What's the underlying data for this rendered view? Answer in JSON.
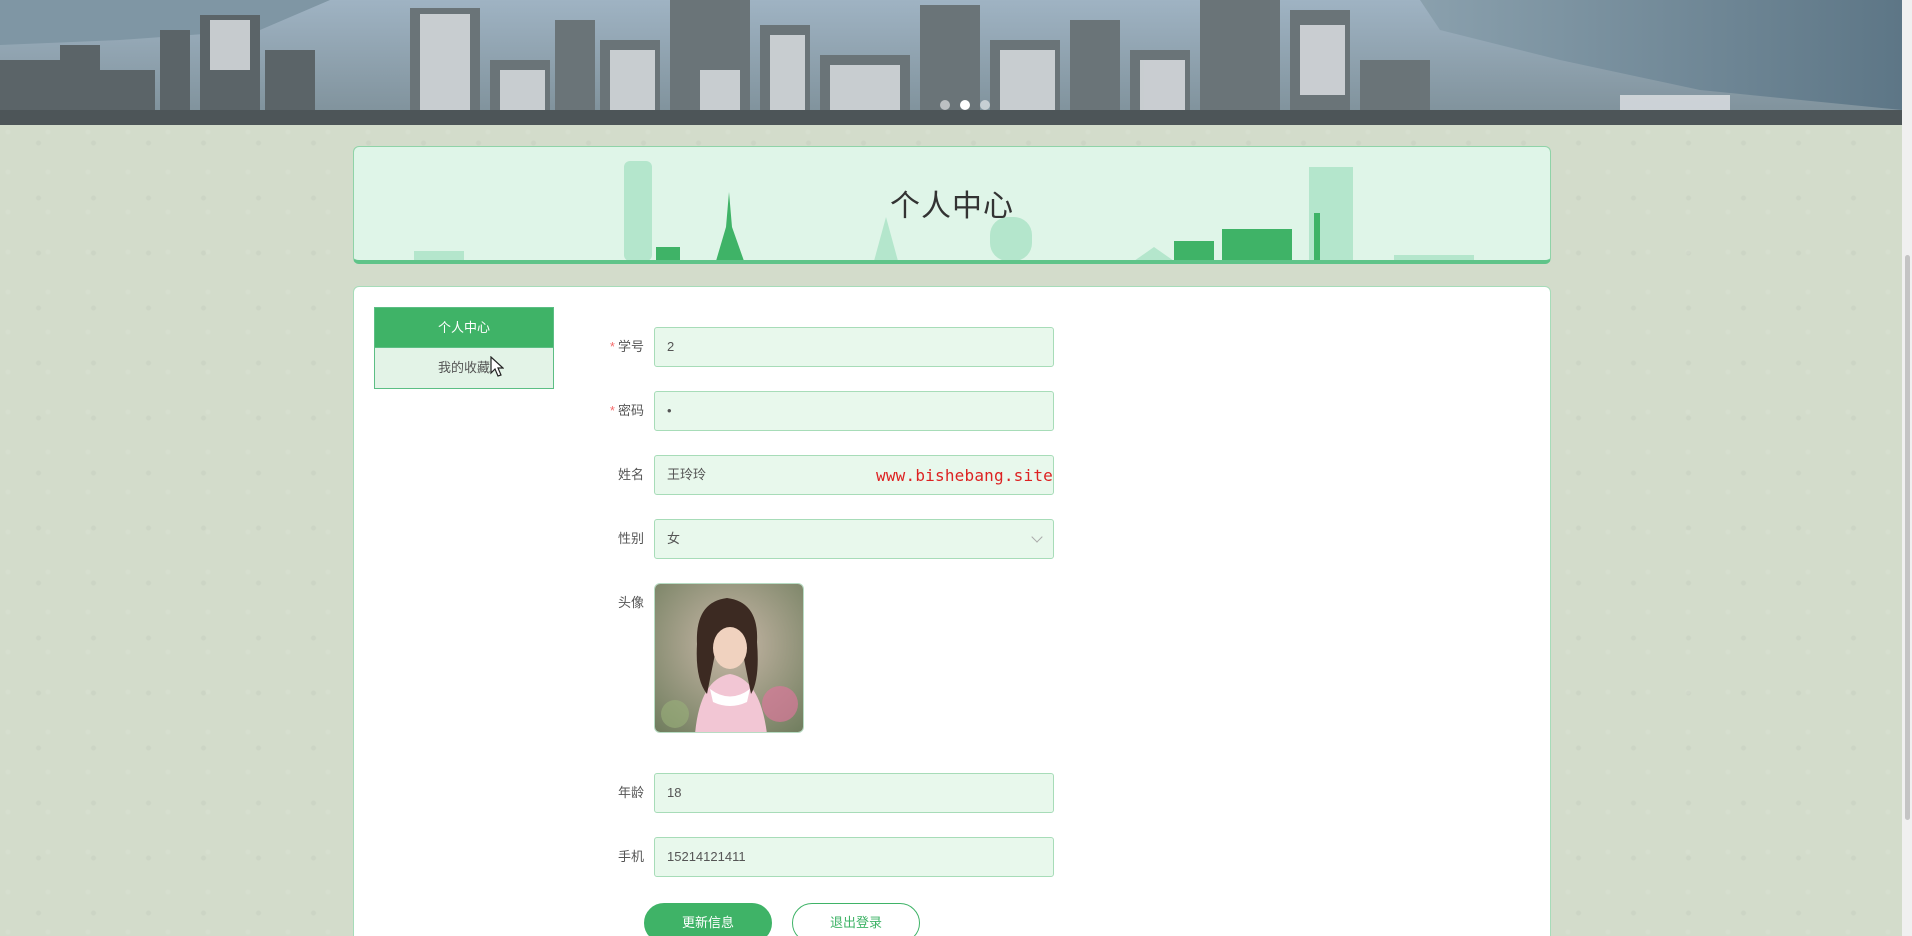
{
  "page": {
    "title": "个人中心"
  },
  "banner": {
    "active_slide": 2,
    "slide_count": 3
  },
  "menu": {
    "items": [
      {
        "label": "个人中心",
        "active": true
      },
      {
        "label": "我的收藏",
        "active": false
      }
    ]
  },
  "form": {
    "student_id": {
      "label": "学号",
      "value": "2",
      "required": true
    },
    "password": {
      "label": "密码",
      "value": "•",
      "required": true
    },
    "name": {
      "label": "姓名",
      "value": "王玲玲"
    },
    "gender": {
      "label": "性别",
      "value": "女"
    },
    "avatar": {
      "label": "头像"
    },
    "age": {
      "label": "年龄",
      "value": "18"
    },
    "phone": {
      "label": "手机",
      "value": "15214121411"
    }
  },
  "buttons": {
    "update": "更新信息",
    "logout": "退出登录"
  },
  "watermark": "www.bishebang.site",
  "colors": {
    "accent": "#3fb367",
    "input_bg": "#e8f8ec",
    "required": "#f56c6c"
  }
}
